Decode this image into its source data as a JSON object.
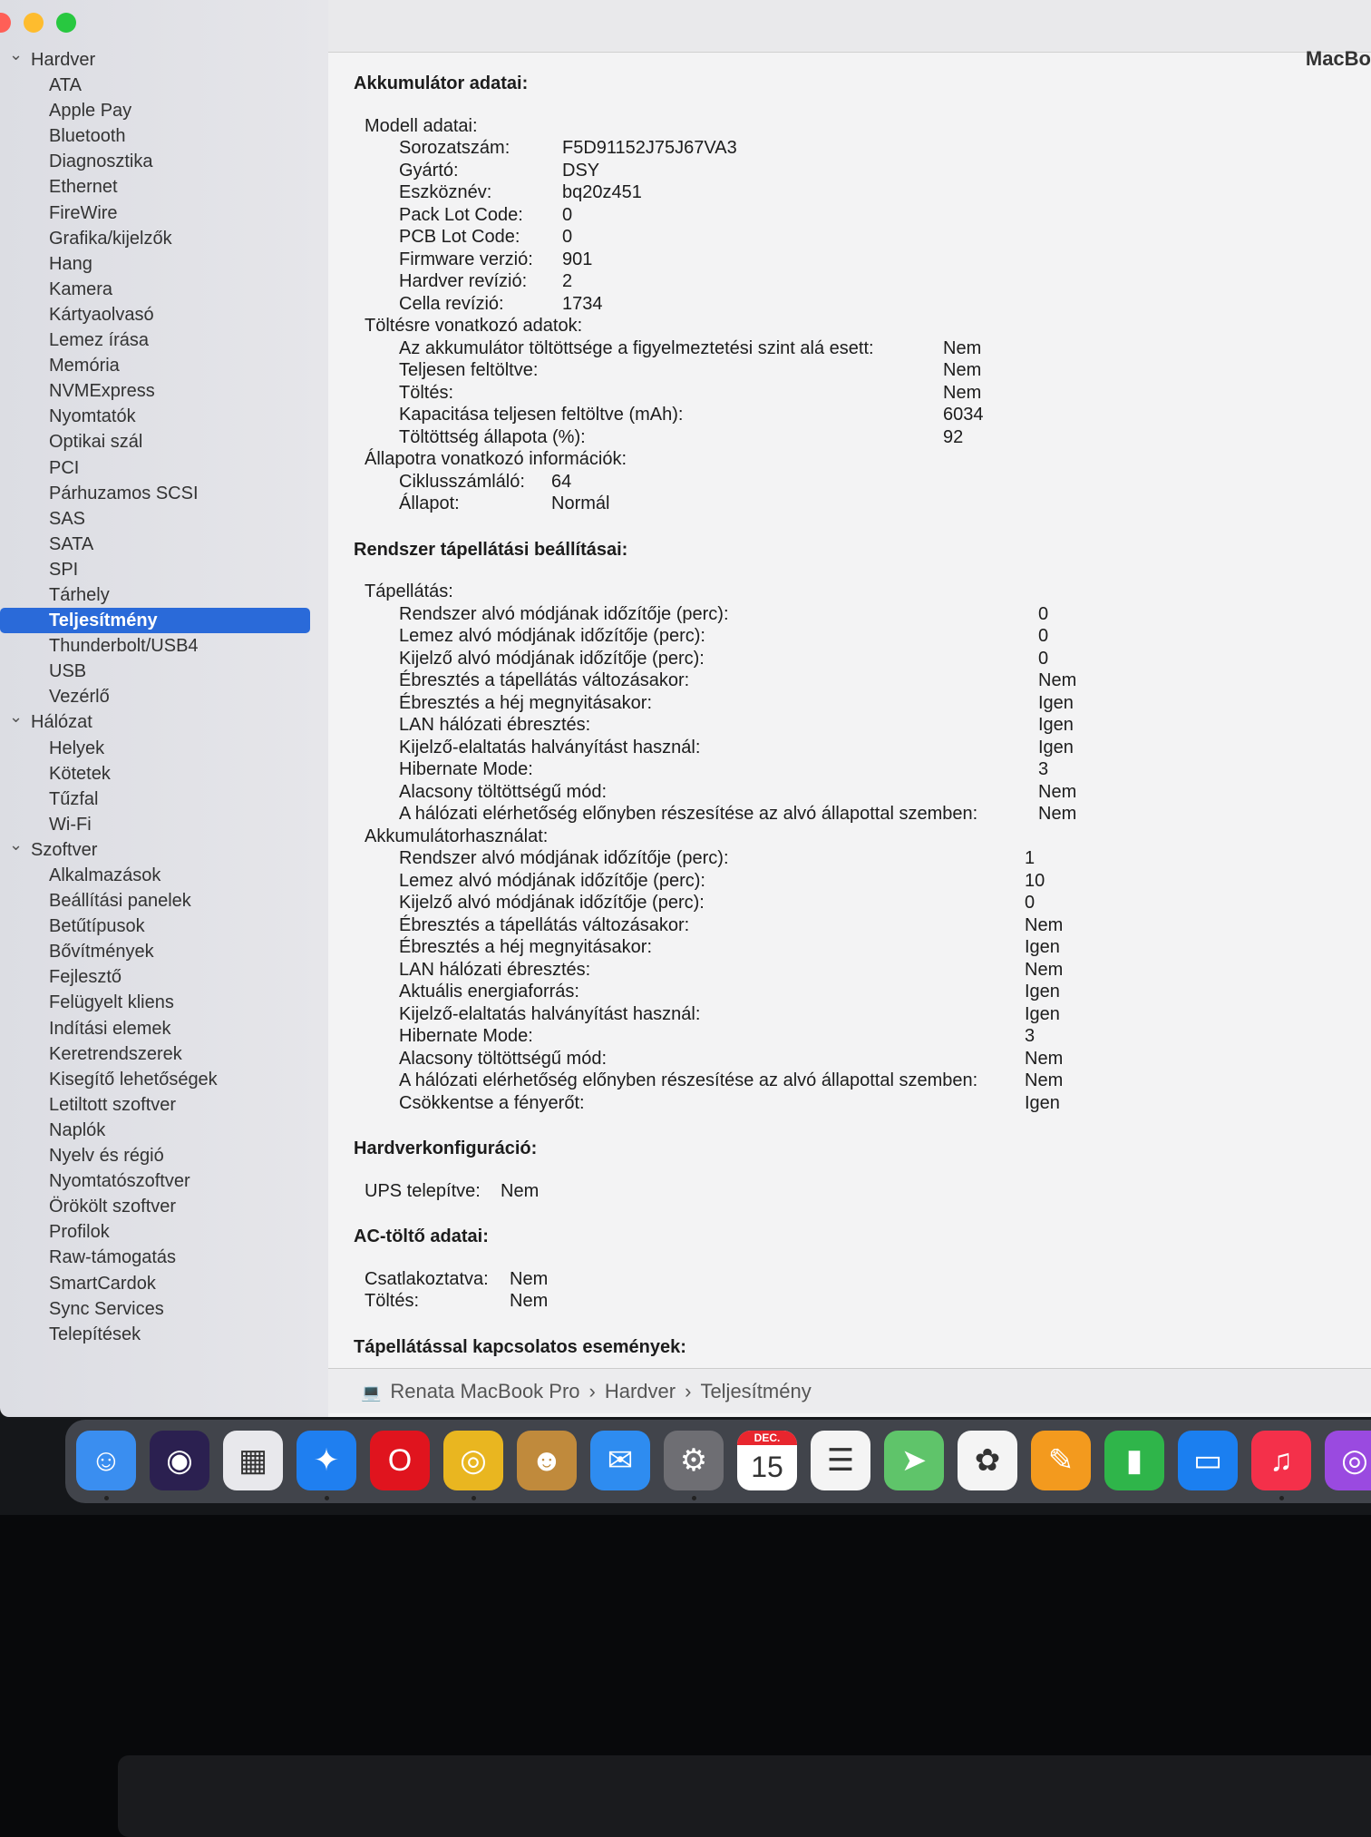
{
  "window": {
    "title": "MacBo",
    "traffic_lights": [
      "#ff5f57",
      "#febc2e",
      "#28c840"
    ]
  },
  "sidebar": {
    "selected": "Teljesítmény",
    "accent": "#2a6ad9",
    "items": [
      {
        "t": "group",
        "label": "Hardver"
      },
      {
        "t": "item",
        "label": "ATA"
      },
      {
        "t": "item",
        "label": "Apple Pay"
      },
      {
        "t": "item",
        "label": "Bluetooth"
      },
      {
        "t": "item",
        "label": "Diagnosztika"
      },
      {
        "t": "item",
        "label": "Ethernet"
      },
      {
        "t": "item",
        "label": "FireWire"
      },
      {
        "t": "item",
        "label": "Grafika/kijelzők"
      },
      {
        "t": "item",
        "label": "Hang"
      },
      {
        "t": "item",
        "label": "Kamera"
      },
      {
        "t": "item",
        "label": "Kártyaolvasó"
      },
      {
        "t": "item",
        "label": "Lemez írása"
      },
      {
        "t": "item",
        "label": "Memória"
      },
      {
        "t": "item",
        "label": "NVMExpress"
      },
      {
        "t": "item",
        "label": "Nyomtatók"
      },
      {
        "t": "item",
        "label": "Optikai szál"
      },
      {
        "t": "item",
        "label": "PCI"
      },
      {
        "t": "item",
        "label": "Párhuzamos SCSI"
      },
      {
        "t": "item",
        "label": "SAS"
      },
      {
        "t": "item",
        "label": "SATA"
      },
      {
        "t": "item",
        "label": "SPI"
      },
      {
        "t": "item",
        "label": "Tárhely"
      },
      {
        "t": "item",
        "label": "Teljesítmény"
      },
      {
        "t": "item",
        "label": "Thunderbolt/USB4"
      },
      {
        "t": "item",
        "label": "USB"
      },
      {
        "t": "item",
        "label": "Vezérlő"
      },
      {
        "t": "group",
        "label": "Hálózat"
      },
      {
        "t": "item",
        "label": "Helyek"
      },
      {
        "t": "item",
        "label": "Kötetek"
      },
      {
        "t": "item",
        "label": "Tűzfal"
      },
      {
        "t": "item",
        "label": "Wi-Fi"
      },
      {
        "t": "group",
        "label": "Szoftver"
      },
      {
        "t": "item",
        "label": "Alkalmazások"
      },
      {
        "t": "item",
        "label": "Beállítási panelek"
      },
      {
        "t": "item",
        "label": "Betűtípusok"
      },
      {
        "t": "item",
        "label": "Bővítmények"
      },
      {
        "t": "item",
        "label": "Fejlesztő"
      },
      {
        "t": "item",
        "label": "Felügyelt kliens"
      },
      {
        "t": "item",
        "label": "Indítási elemek"
      },
      {
        "t": "item",
        "label": "Keretrendszerek"
      },
      {
        "t": "item",
        "label": "Kisegítő lehetőségek"
      },
      {
        "t": "item",
        "label": "Letiltott szoftver"
      },
      {
        "t": "item",
        "label": "Naplók"
      },
      {
        "t": "item",
        "label": "Nyelv és régió"
      },
      {
        "t": "item",
        "label": "Nyomtatószoftver"
      },
      {
        "t": "item",
        "label": "Örökölt szoftver"
      },
      {
        "t": "item",
        "label": "Profilok"
      },
      {
        "t": "item",
        "label": "Raw-támogatás"
      },
      {
        "t": "item",
        "label": "SmartCardok"
      },
      {
        "t": "item",
        "label": "Sync Services"
      },
      {
        "t": "item",
        "label": "Telepítések"
      }
    ]
  },
  "sections": [
    {
      "title": "Akkumulátor adatai:",
      "rows": [
        {
          "lv": 0,
          "k": "Modell adatai:",
          "v": ""
        },
        {
          "lv": 1,
          "k": "Sorozatszám:",
          "v": "F5D91152J75J67VA3",
          "w": 180
        },
        {
          "lv": 1,
          "k": "Gyártó:",
          "v": "DSY",
          "w": 180
        },
        {
          "lv": 1,
          "k": "Eszköznév:",
          "v": "bq20z451",
          "w": 180
        },
        {
          "lv": 1,
          "k": "Pack Lot Code:",
          "v": "0",
          "w": 180
        },
        {
          "lv": 1,
          "k": "PCB Lot Code:",
          "v": "0",
          "w": 180
        },
        {
          "lv": 1,
          "k": "Firmware verzió:",
          "v": "901",
          "w": 180
        },
        {
          "lv": 1,
          "k": "Hardver revízió:",
          "v": "2",
          "w": 180
        },
        {
          "lv": 1,
          "k": "Cella revízió:",
          "v": "1734",
          "w": 180
        },
        {
          "lv": 0,
          "k": "Töltésre vonatkozó adatok:",
          "v": ""
        },
        {
          "lv": 1,
          "k": "Az akkumulátor töltöttsége a figyelmeztetési szint alá esett:",
          "v": "Nem",
          "w": 600
        },
        {
          "lv": 1,
          "k": "Teljesen feltöltve:",
          "v": "Nem",
          "w": 600
        },
        {
          "lv": 1,
          "k": "Töltés:",
          "v": "Nem",
          "w": 600
        },
        {
          "lv": 1,
          "k": "Kapacitása teljesen feltöltve (mAh):",
          "v": "6034",
          "w": 600
        },
        {
          "lv": 1,
          "k": "Töltöttség állapota (%):",
          "v": "92",
          "w": 600
        },
        {
          "lv": 0,
          "k": "Állapotra vonatkozó információk:",
          "v": ""
        },
        {
          "lv": 1,
          "k": "Ciklusszámláló:",
          "v": "64",
          "w": 168
        },
        {
          "lv": 1,
          "k": "Állapot:",
          "v": "Normál",
          "w": 168
        }
      ]
    },
    {
      "title": "Rendszer tápellátási beállításai:",
      "rows": [
        {
          "lv": 0,
          "k": "Tápellátás:",
          "v": ""
        },
        {
          "lv": 1,
          "k": "Rendszer alvó módjának időzítője (perc):",
          "v": "0",
          "w": 705
        },
        {
          "lv": 1,
          "k": "Lemez alvó módjának időzítője (perc):",
          "v": "0",
          "w": 705
        },
        {
          "lv": 1,
          "k": "Kijelző alvó módjának időzítője (perc):",
          "v": "0",
          "w": 705
        },
        {
          "lv": 1,
          "k": "Ébresztés a tápellátás változásakor:",
          "v": "Nem",
          "w": 705
        },
        {
          "lv": 1,
          "k": "Ébresztés a héj megnyitásakor:",
          "v": "Igen",
          "w": 705
        },
        {
          "lv": 1,
          "k": "LAN hálózati ébresztés:",
          "v": "Igen",
          "w": 705
        },
        {
          "lv": 1,
          "k": "Kijelző-elaltatás halványítást használ:",
          "v": "Igen",
          "w": 705
        },
        {
          "lv": 1,
          "k": "Hibernate Mode:",
          "v": "3",
          "w": 705
        },
        {
          "lv": 1,
          "k": "Alacsony töltöttségű mód:",
          "v": "Nem",
          "w": 705
        },
        {
          "lv": 1,
          "k": "A hálózati elérhetőség előnyben részesítése az alvó állapottal szemben:",
          "v": "Nem",
          "w": 705
        },
        {
          "lv": 0,
          "k": "Akkumulátorhasználat:",
          "v": ""
        },
        {
          "lv": 1,
          "k": "Rendszer alvó módjának időzítője (perc):",
          "v": "1",
          "w": 690
        },
        {
          "lv": 1,
          "k": "Lemez alvó módjának időzítője (perc):",
          "v": "10",
          "w": 690
        },
        {
          "lv": 1,
          "k": "Kijelző alvó módjának időzítője (perc):",
          "v": "0",
          "w": 690
        },
        {
          "lv": 1,
          "k": "Ébresztés a tápellátás változásakor:",
          "v": "Nem",
          "w": 690
        },
        {
          "lv": 1,
          "k": "Ébresztés a héj megnyitásakor:",
          "v": "Igen",
          "w": 690
        },
        {
          "lv": 1,
          "k": "LAN hálózati ébresztés:",
          "v": "Nem",
          "w": 690
        },
        {
          "lv": 1,
          "k": "Aktuális energiaforrás:",
          "v": "Igen",
          "w": 690
        },
        {
          "lv": 1,
          "k": "Kijelző-elaltatás halványítást használ:",
          "v": "Igen",
          "w": 690
        },
        {
          "lv": 1,
          "k": "Hibernate Mode:",
          "v": "3",
          "w": 690
        },
        {
          "lv": 1,
          "k": "Alacsony töltöttségű mód:",
          "v": "Nem",
          "w": 690
        },
        {
          "lv": 1,
          "k": "A hálózati elérhetőség előnyben részesítése az alvó állapottal szemben:",
          "v": "Nem",
          "w": 690
        },
        {
          "lv": 1,
          "k": "Csökkentse a fényerőt:",
          "v": "Igen",
          "w": 690
        }
      ]
    },
    {
      "title": "Hardverkonfiguráció:",
      "rows": [
        {
          "lv": 0,
          "k": "UPS telepítve:",
          "v": "Nem",
          "w": 150
        }
      ]
    },
    {
      "title": "AC-töltő adatai:",
      "rows": [
        {
          "lv": 0,
          "k": "Csatlakoztatva:",
          "v": "Nem",
          "w": 160
        },
        {
          "lv": 0,
          "k": "Töltés:",
          "v": "Nem",
          "w": 160
        }
      ]
    },
    {
      "title": "Tápellátással kapcsolatos események:",
      "rows": []
    }
  ],
  "pathbar": {
    "icon": "laptop-icon",
    "crumbs": [
      "Renata MacBook Pro",
      "›",
      "Hardver",
      "›",
      "Teljesítmény"
    ]
  },
  "dock": [
    {
      "name": "finder",
      "g": "☺",
      "c": "#3a8ef0",
      "run": true
    },
    {
      "name": "siri",
      "g": "◉",
      "c": "#2b2050"
    },
    {
      "name": "launchpad",
      "g": "▦",
      "c": "#e8e8ec"
    },
    {
      "name": "safari",
      "g": "✦",
      "c": "#1f7ff0",
      "run": true
    },
    {
      "name": "opera",
      "g": "O",
      "c": "#e0141e"
    },
    {
      "name": "chrome",
      "g": "◎",
      "c": "#e9b620",
      "run": true
    },
    {
      "name": "contacts",
      "g": "☻",
      "c": "#c08a3c"
    },
    {
      "name": "mail",
      "g": "✉",
      "c": "#2e8cf0"
    },
    {
      "name": "system-settings",
      "g": "⚙",
      "c": "#6e6e73",
      "run": true
    },
    {
      "name": "calendar",
      "g": "15",
      "c": "#ffffff",
      "label": "DEC."
    },
    {
      "name": "reminders",
      "g": "☰",
      "c": "#f4f4f4"
    },
    {
      "name": "maps",
      "g": "➤",
      "c": "#5fc46a"
    },
    {
      "name": "photos",
      "g": "✿",
      "c": "#f4f4f4"
    },
    {
      "name": "pages",
      "g": "✎",
      "c": "#f39a1e"
    },
    {
      "name": "numbers",
      "g": "▮",
      "c": "#2fb54a"
    },
    {
      "name": "keynote",
      "g": "▭",
      "c": "#1b7ff0"
    },
    {
      "name": "music",
      "g": "♫",
      "c": "#f4304a",
      "run": true
    },
    {
      "name": "podcasts",
      "g": "◎",
      "c": "#9a4ae0"
    }
  ]
}
